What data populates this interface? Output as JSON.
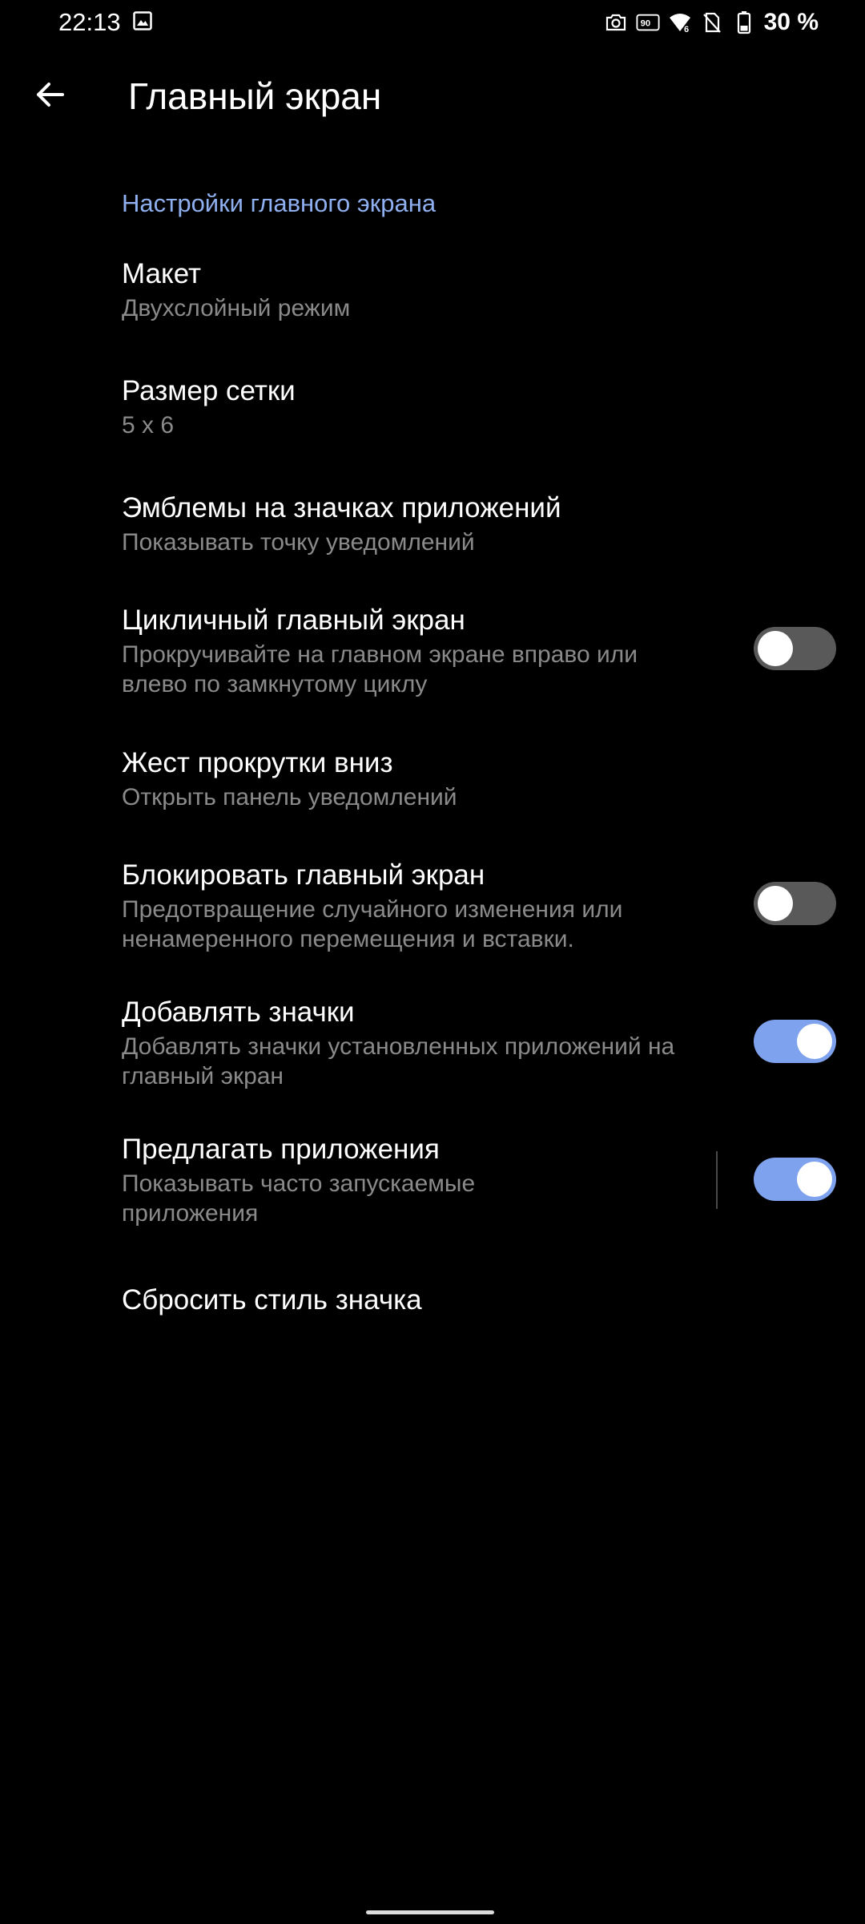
{
  "status_bar": {
    "time": "22:13",
    "battery": "30 %",
    "icons": [
      "gallery-icon",
      "camera-icon",
      "refresh-rate-icon",
      "wifi-icon",
      "no-sim-icon",
      "battery-icon"
    ]
  },
  "app_bar": {
    "title": "Главный экран",
    "back_icon": "arrow-back-icon"
  },
  "section": {
    "title": "Настройки главного экрана"
  },
  "settings": [
    {
      "title": "Макет",
      "subtitle": "Двухслойный режим"
    },
    {
      "title": "Размер сетки",
      "subtitle": "5 x 6"
    },
    {
      "title": "Эмблемы на значках приложений",
      "subtitle": "Показывать точку уведомлений"
    },
    {
      "title": "Цикличный главный экран",
      "subtitle": "Прокручивайте на главном экране вправо или влево по замкнутому циклу",
      "toggle": false
    },
    {
      "title": "Жест прокрутки вниз",
      "subtitle": "Открыть панель уведомлений"
    },
    {
      "title": "Блокировать главный экран",
      "subtitle": "Предотвращение случайного изменения или ненамеренного перемещения и вставки.",
      "toggle": false
    },
    {
      "title": "Добавлять значки",
      "subtitle": "Добавлять значки установленных приложений на главный экран",
      "toggle": true
    },
    {
      "title": "Предлагать приложения",
      "subtitle": "Показывать часто запускаемые приложения",
      "toggle": true
    },
    {
      "title": "Сбросить стиль значка"
    }
  ],
  "colors": {
    "background": "#000000",
    "accent": "#8fb0f0",
    "toggle_on": "#7ea2ee",
    "toggle_off": "#595959",
    "subtitle": "#8a8a8a"
  }
}
